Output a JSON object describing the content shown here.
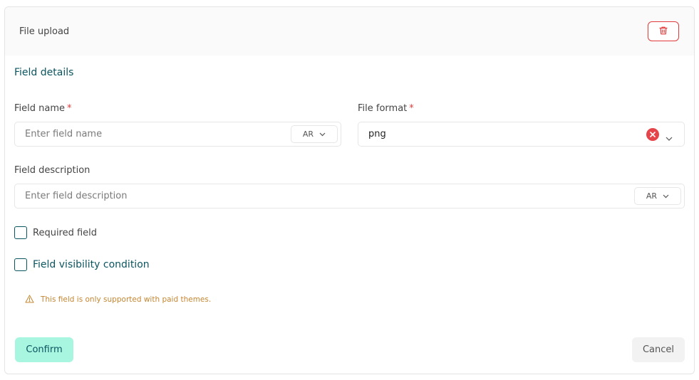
{
  "header": {
    "title": "File upload",
    "delete_icon": "trash-icon",
    "delete_color": "#e23b3b"
  },
  "section": {
    "title": "Field details"
  },
  "field_name": {
    "label": "Field name",
    "required_mark": "*",
    "placeholder": "Enter field name",
    "value": "",
    "lang": "AR"
  },
  "file_format": {
    "label": "File format",
    "required_mark": "*",
    "value": "png",
    "clear_icon": "clear-icon",
    "chevron_icon": "chevron-down-icon"
  },
  "field_description": {
    "label": "Field description",
    "placeholder": "Enter field description",
    "value": "",
    "lang": "AR"
  },
  "checkboxes": {
    "required": {
      "label": "Required field",
      "checked": false
    },
    "visibility": {
      "label": "Field visibility condition",
      "checked": false
    }
  },
  "warning": {
    "icon": "warning-icon",
    "text": "This field is only supported with paid themes.",
    "color": "#c48631"
  },
  "actions": {
    "confirm": "Confirm",
    "cancel": "Cancel"
  },
  "colors": {
    "accent": "#0b5560",
    "confirm_bg": "#a8f5e0",
    "danger": "#e23b3b"
  }
}
